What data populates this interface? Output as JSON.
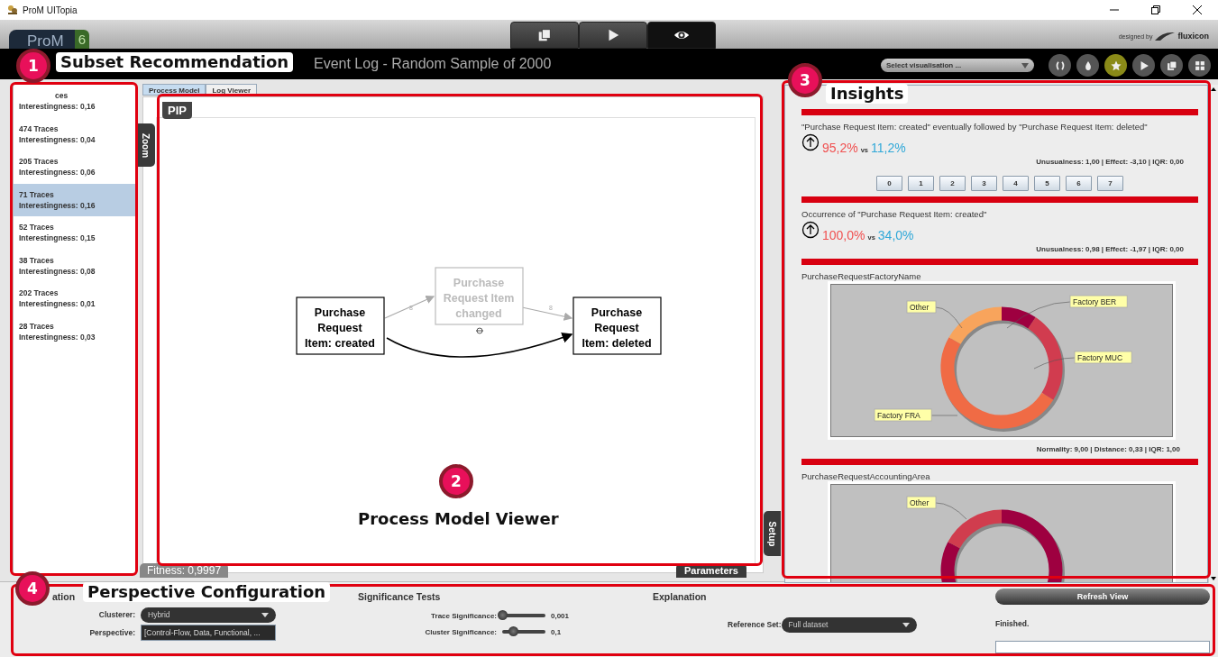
{
  "app": {
    "title": "ProM UITopia"
  },
  "logo": {
    "text": "ProM",
    "version": "6"
  },
  "view_tabs": [
    {
      "kind": "copy",
      "selected": false
    },
    {
      "kind": "play",
      "selected": false
    },
    {
      "kind": "eye",
      "selected": true
    }
  ],
  "credit": {
    "prefix": "designed by",
    "brand": "fluxicon"
  },
  "header": {
    "title": "Event Log - Random Sample of 2000",
    "visualisation_select": {
      "placeholder": "Select visualisation ..."
    },
    "tools": [
      {
        "kind": "reset",
        "selected": false
      },
      {
        "kind": "drop",
        "selected": false
      },
      {
        "kind": "star",
        "selected": true
      },
      {
        "kind": "play",
        "selected": false
      },
      {
        "kind": "copy",
        "selected": false
      },
      {
        "kind": "grid",
        "selected": false
      }
    ]
  },
  "subsets": [
    {
      "traces": "ces",
      "interestingness": "Interestingness: 0,16",
      "selected": false
    },
    {
      "traces": "474 Traces",
      "interestingness": "Interestingness: 0,04",
      "selected": false
    },
    {
      "traces": "205 Traces",
      "interestingness": "Interestingness: 0,06",
      "selected": false
    },
    {
      "traces": "71 Traces",
      "interestingness": "Interestingness: 0,16",
      "selected": true
    },
    {
      "traces": "52 Traces",
      "interestingness": "Interestingness: 0,15",
      "selected": false
    },
    {
      "traces": "38 Traces",
      "interestingness": "Interestingness: 0,08",
      "selected": false
    },
    {
      "traces": "202 Traces",
      "interestingness": "Interestingness: 0,01",
      "selected": false
    },
    {
      "traces": "28 Traces",
      "interestingness": "Interestingness: 0,03",
      "selected": false
    }
  ],
  "model_view": {
    "tabs": [
      {
        "label": "Process Model",
        "selected": true
      },
      {
        "label": "Log Viewer",
        "selected": false
      }
    ],
    "pip_button": "PIP",
    "zoom_tab": "Zoom",
    "setup_tab": "Setup",
    "fitness": "Fitness: 0,9997",
    "parameters_button": "Parameters",
    "nodes": [
      {
        "lines": [
          "Purchase",
          "Request",
          "Item: created"
        ],
        "kind": "active"
      },
      {
        "lines": [
          "Purchase",
          "Request Item",
          "changed"
        ],
        "kind": "faded"
      },
      {
        "lines": [
          "Purchase",
          "Request",
          "Item: deleted"
        ],
        "kind": "active"
      }
    ],
    "edge_labels": [
      "8",
      "8"
    ]
  },
  "insights": [
    {
      "kind": "rule",
      "title": "\"Purchase Request Item: created\" eventually followed by \"Purchase Request Item: deleted\"",
      "value_a": "95,2%",
      "vs": "vs",
      "value_b": "11,2%",
      "stats": "Unusualness: 1,00 | Effect: -3,10 | IQR: 0,00",
      "buttons": [
        "0",
        "1",
        "2",
        "3",
        "4",
        "5",
        "6",
        "7"
      ]
    },
    {
      "kind": "rule",
      "title": "Occurrence of \"Purchase Request Item: created\"",
      "value_a": "100,0%",
      "vs": "vs",
      "value_b": "34,0%",
      "stats": "Unusualness: 0,98 | Effect: -1,97 | IQR: 0,00"
    },
    {
      "kind": "distribution",
      "title": "PurchaseRequestFactoryName",
      "slices": [
        {
          "label": "Factory BER",
          "color": "#9e0040"
        },
        {
          "label": "Factory MUC",
          "color": "#d13c4f"
        },
        {
          "label": "Factory FRA",
          "color": "#f06b45"
        },
        {
          "label": "Other",
          "color": "#f8a45c"
        }
      ],
      "stats": "Normality: 9,00 | Distance: 0,33 | IQR: 1,00"
    },
    {
      "kind": "distribution",
      "title": "PurchaseRequestAccountingArea",
      "slices": [
        {
          "color": "#9e0040"
        },
        {
          "label": "Other",
          "color": "#d03d4e"
        }
      ]
    }
  ],
  "configuration": {
    "clustering": {
      "heading": "ation",
      "clusterer_label": "Clusterer:",
      "clusterer": "Hybrid",
      "perspective_label": "Perspective:",
      "perspective": "[Control-Flow, Data, Functional, ..."
    },
    "significance": {
      "heading": "Significance Tests",
      "sliders": [
        {
          "label": "Trace Significance:",
          "level": 0.0,
          "reading": "0,001"
        },
        {
          "label": "Cluster Significance:",
          "level": 0.25,
          "reading": "0,1"
        }
      ]
    },
    "explanation": {
      "heading": "Explanation",
      "reference_label": "Reference Set:",
      "reference": "Full dataset"
    },
    "refresh_button": "Refresh View",
    "status": "Finished."
  },
  "annotations": [
    {
      "number": "1",
      "label": "Subset Recommendation"
    },
    {
      "number": "2",
      "label": "Process Model Viewer"
    },
    {
      "number": "3",
      "label": "Insights"
    },
    {
      "number": "4",
      "label": "Perspective Configuration"
    }
  ]
}
